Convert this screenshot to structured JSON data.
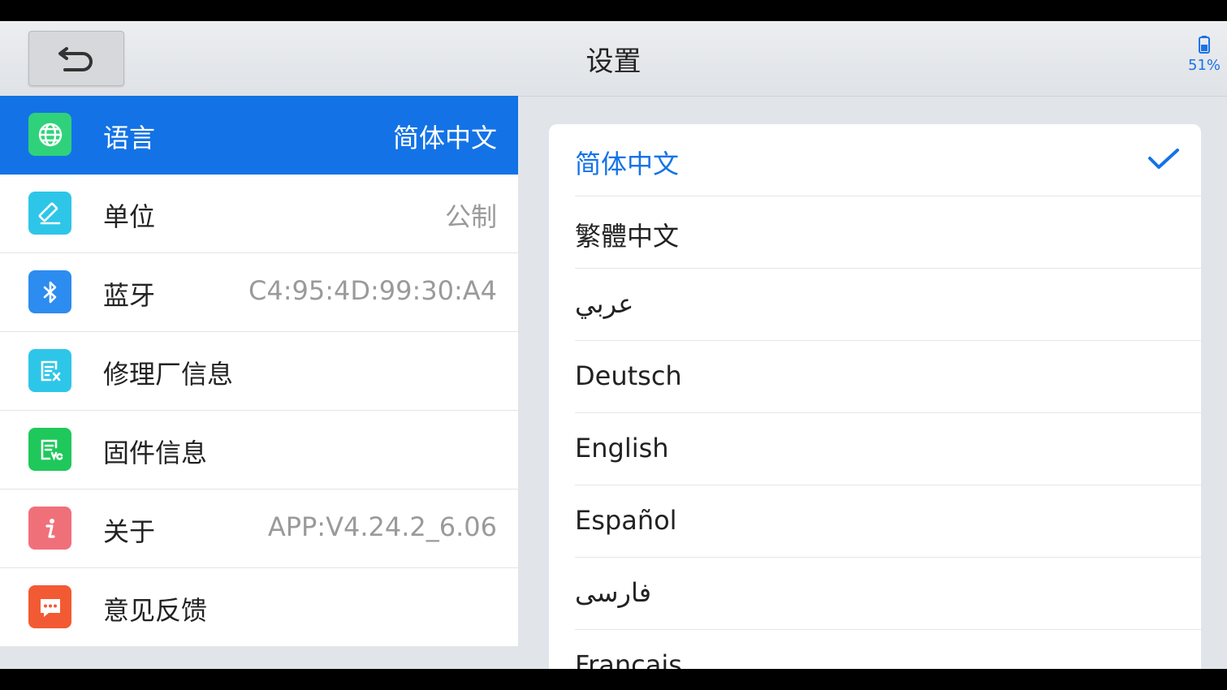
{
  "header": {
    "title": "设置",
    "battery_text": "51%"
  },
  "menu": [
    {
      "label": "语言",
      "value": "简体中文",
      "icon": "globe-icon",
      "color": "#2fd27a",
      "active": true
    },
    {
      "label": "单位",
      "value": "公制",
      "icon": "ruler-icon",
      "color": "#2ec6e8",
      "active": false
    },
    {
      "label": "蓝牙",
      "value": "C4:95:4D:99:30:A4",
      "icon": "bluetooth-icon",
      "color": "#2d8cf0",
      "active": false
    },
    {
      "label": "修理厂信息",
      "value": "",
      "icon": "workshop-info-icon",
      "color": "#2ec6e8",
      "active": false
    },
    {
      "label": "固件信息",
      "value": "",
      "icon": "firmware-info-icon",
      "color": "#1fc85a",
      "active": false
    },
    {
      "label": "关于",
      "value": "APP:V4.24.2_6.06",
      "icon": "info-icon",
      "color": "#f0707a",
      "active": false
    },
    {
      "label": "意见反馈",
      "value": "",
      "icon": "feedback-icon",
      "color": "#f25a33",
      "active": false
    }
  ],
  "languages": [
    {
      "label": "简体中文",
      "selected": true
    },
    {
      "label": "繁體中文",
      "selected": false
    },
    {
      "label": "عربي",
      "selected": false
    },
    {
      "label": "Deutsch",
      "selected": false
    },
    {
      "label": "English",
      "selected": false
    },
    {
      "label": "Español",
      "selected": false
    },
    {
      "label": "فارسی",
      "selected": false
    },
    {
      "label": "Français",
      "selected": false
    }
  ],
  "colors": {
    "accent": "#1373e6",
    "background": "#e1e5ea"
  }
}
